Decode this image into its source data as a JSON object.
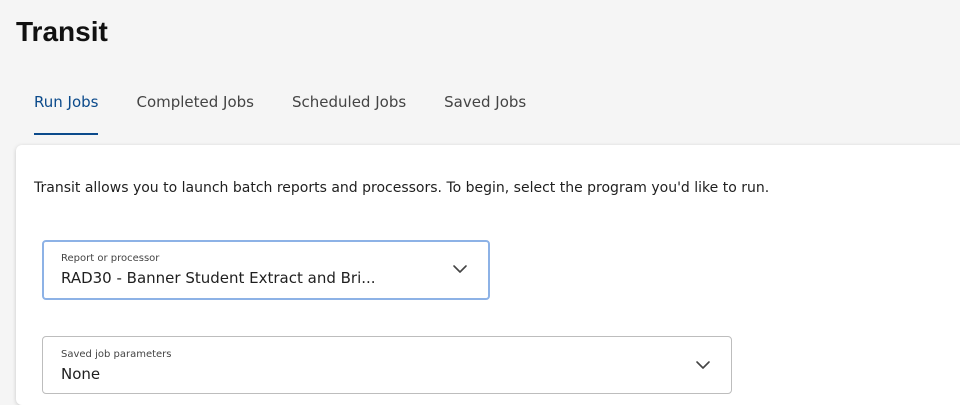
{
  "page": {
    "title": "Transit"
  },
  "tabs": [
    {
      "label": "Run Jobs",
      "active": true
    },
    {
      "label": "Completed Jobs",
      "active": false
    },
    {
      "label": "Scheduled Jobs",
      "active": false
    },
    {
      "label": "Saved Jobs",
      "active": false
    }
  ],
  "main": {
    "intro_text": "Transit allows you to launch batch reports and processors. To begin, select the program you'd like to run.",
    "report_select": {
      "label": "Report or processor",
      "value": "RAD30 - Banner Student Extract and Bri...",
      "icon": "chevron-down-icon"
    },
    "saved_params_select": {
      "label": "Saved job parameters",
      "value": "None",
      "icon": "chevron-down-icon"
    }
  },
  "colors": {
    "accent": "#0b4a8b",
    "focus_border": "#8db2e6",
    "page_bg": "#f5f5f5"
  }
}
